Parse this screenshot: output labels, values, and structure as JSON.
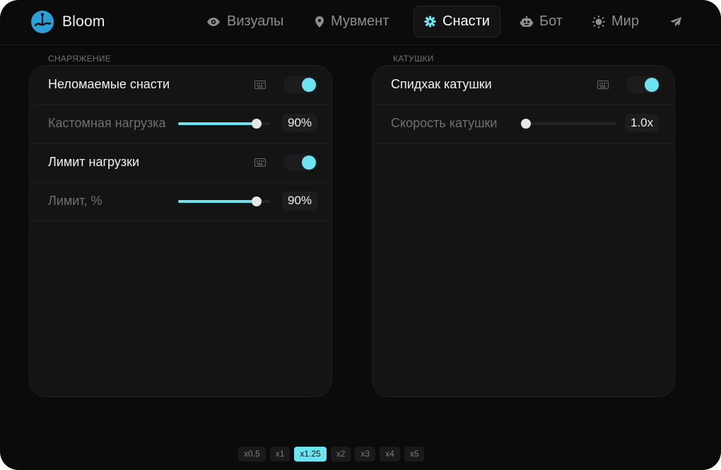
{
  "app": {
    "name": "Bloom",
    "accent": "#6be3f0"
  },
  "tabs": [
    {
      "label": "Визуалы",
      "icon": "eye-icon",
      "active": false
    },
    {
      "label": "Мувмент",
      "icon": "map-pin-icon",
      "active": false
    },
    {
      "label": "Снасти",
      "icon": "gear-icon",
      "active": true
    },
    {
      "label": "Бот",
      "icon": "robot-icon",
      "active": false
    },
    {
      "label": "Мир",
      "icon": "sun-icon",
      "active": false
    },
    {
      "label": "",
      "icon": "send-icon",
      "active": false
    }
  ],
  "sections": {
    "gear": {
      "title": "СНАРЯЖЕНИЕ",
      "unbreakable": {
        "label": "Неломаемые снасти",
        "enabled": true
      },
      "custom_load": {
        "label": "Кастомная нагрузка",
        "value_text": "90%",
        "fraction": 0.9
      },
      "load_limit": {
        "label": "Лимит нагрузки",
        "enabled": true
      },
      "limit_percent": {
        "label": "Лимит, %",
        "value_text": "90%",
        "fraction": 0.9
      }
    },
    "reels": {
      "title": "КАТУШКИ",
      "speedhack": {
        "label": "Спидхак катушки",
        "enabled": true
      },
      "reel_speed": {
        "label": "Скорость катушки",
        "value_text": "1.0x",
        "fraction": 0.0
      }
    }
  },
  "speed_options": [
    {
      "label": "x0.5",
      "active": false
    },
    {
      "label": "x1",
      "active": false
    },
    {
      "label": "x1.25",
      "active": true
    },
    {
      "label": "x2",
      "active": false
    },
    {
      "label": "x3",
      "active": false
    },
    {
      "label": "x4",
      "active": false
    },
    {
      "label": "x5",
      "active": false
    }
  ]
}
